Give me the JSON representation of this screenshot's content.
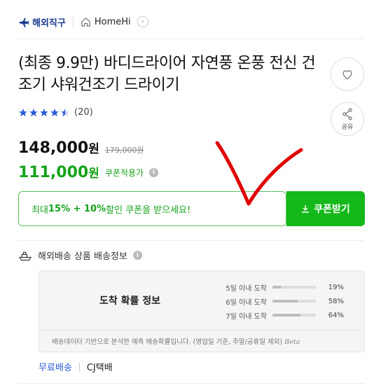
{
  "seller": {
    "overseas_label": "해외직구",
    "store_name": "HomeHi"
  },
  "product": {
    "title": "(최종 9.9만) 바디드라이어 자연풍 온풍 전신 건조기 샤워건조기 드라이기",
    "rating_value": 4.5,
    "review_count": "(20)"
  },
  "actions": {
    "wish_icon": "heart-icon",
    "share_label": "공유"
  },
  "price": {
    "sale_price": "148,000",
    "original_price": "179,000원",
    "coupon_price": "111,000",
    "currency": "원",
    "coupon_applied_label": "쿠폰적용가"
  },
  "coupon": {
    "banner_prefix": "최대 ",
    "banner_bold": "15% + 10%",
    "banner_suffix": " 할인 쿠폰을 받으세요!",
    "button_label": "쿠폰받기"
  },
  "shipping": {
    "section_title": "해외배송 상품 배송정보",
    "arrival_title": "도착 확률 정보",
    "arrival_rows": [
      {
        "label": "5일 이내 도착",
        "percent": "19%",
        "ratio": 0.19
      },
      {
        "label": "6일 이내 도착",
        "percent": "58%",
        "ratio": 0.58
      },
      {
        "label": "7일 이내 도착",
        "percent": "64%",
        "ratio": 0.64
      }
    ],
    "note": "배송데이터 기반으로 분석한 예측 배송확률입니다. (영업일 기준, 주말/공휴일 제외)",
    "beta_label": "Beta",
    "free_shipping": "무료배송",
    "carrier": "CJ택배"
  },
  "colors": {
    "accent_green": "#14b81a",
    "coupon_text": "#14a31a",
    "link_blue": "#2b5bd7",
    "annotation_red": "#e00000",
    "star_blue": "#2b5bd7"
  }
}
